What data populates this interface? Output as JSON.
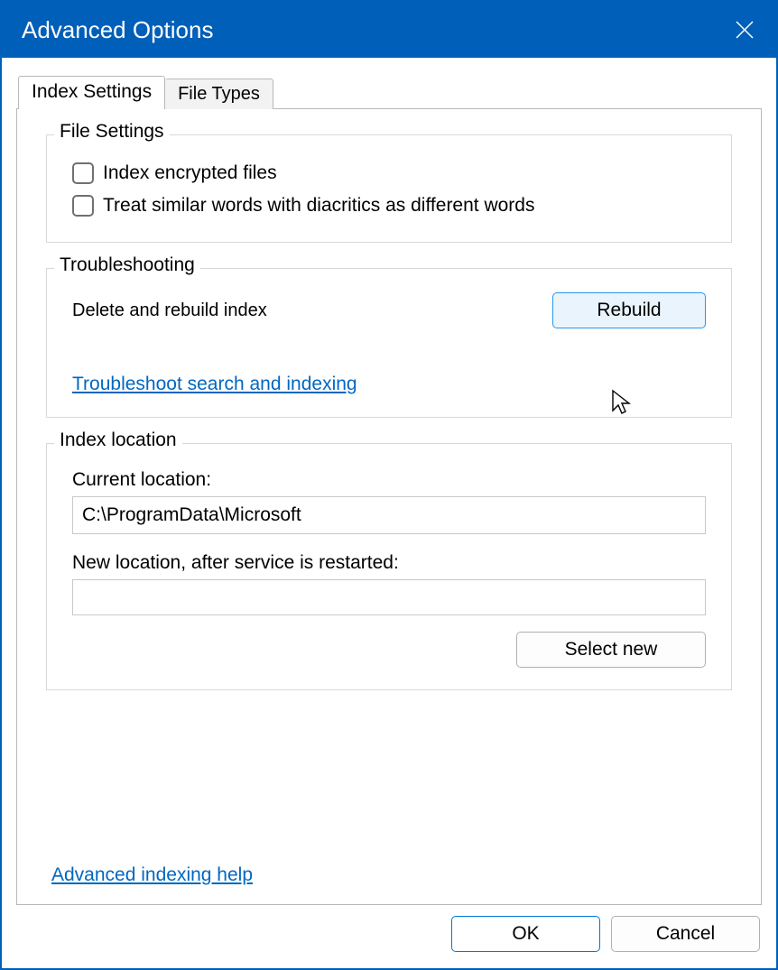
{
  "window": {
    "title": "Advanced Options"
  },
  "tabs": {
    "index_settings": "Index Settings",
    "file_types": "File Types"
  },
  "file_settings": {
    "legend": "File Settings",
    "encrypt": "Index encrypted files",
    "diacritics": "Treat similar words with diacritics as different words"
  },
  "troubleshooting": {
    "legend": "Troubleshooting",
    "delete_rebuild": "Delete and rebuild index",
    "rebuild_btn": "Rebuild",
    "troubleshoot_link": "Troubleshoot search and indexing"
  },
  "index_location": {
    "legend": "Index location",
    "current_label": "Current location:",
    "current_value": "C:\\ProgramData\\Microsoft",
    "new_label": "New location, after service is restarted:",
    "new_value": "",
    "select_new": "Select new"
  },
  "help_link": "Advanced indexing help",
  "buttons": {
    "ok": "OK",
    "cancel": "Cancel"
  }
}
